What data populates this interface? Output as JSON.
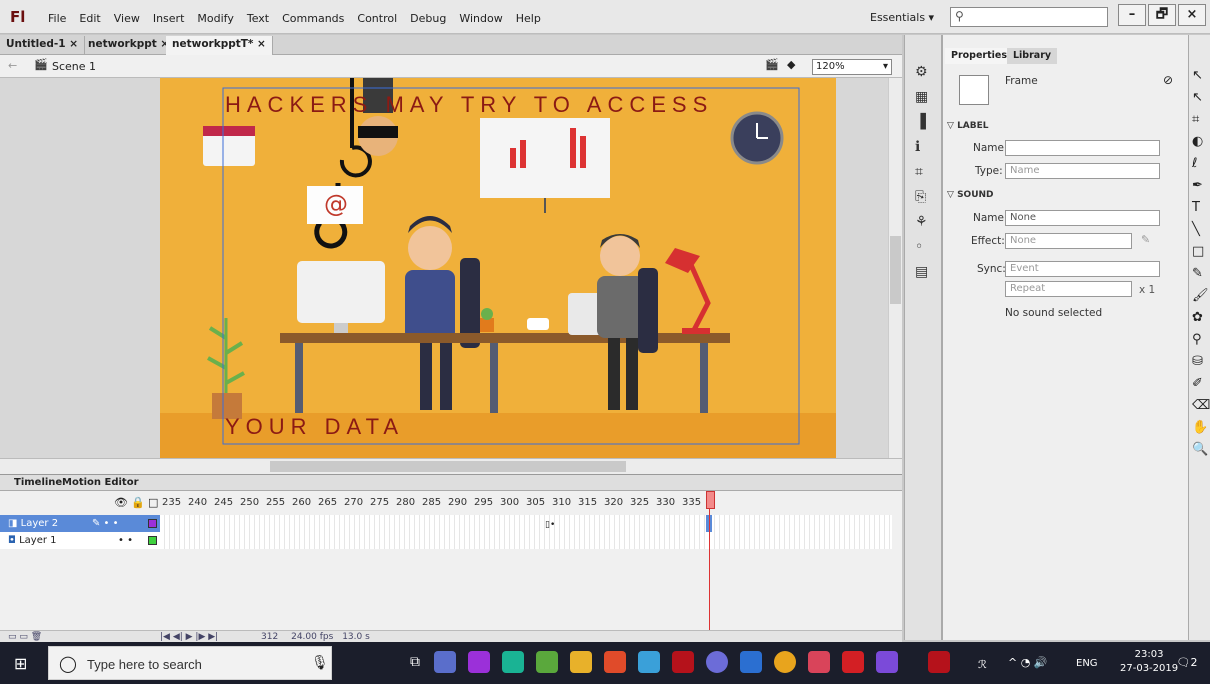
{
  "app": {
    "logo": "Fl"
  },
  "menu": [
    "File",
    "Edit",
    "View",
    "Insert",
    "Modify",
    "Text",
    "Commands",
    "Control",
    "Debug",
    "Window",
    "Help"
  ],
  "workspace": "Essentials",
  "window_buttons": [
    "–",
    "🗗",
    "×"
  ],
  "tabs": [
    {
      "label": "Untitled-1 ×",
      "active": false
    },
    {
      "label": "networkppt ×",
      "active": false
    },
    {
      "label": "networkpptT* ×",
      "active": true
    }
  ],
  "scene": {
    "label": "Scene 1",
    "zoom": "120%"
  },
  "stage_text": {
    "top": "HACKERS MAY TRY TO ACCESS",
    "bottom": "YOUR DATA",
    "email_symbol": "@"
  },
  "timeline": {
    "tabs": [
      "Timeline",
      "Motion Editor"
    ],
    "ruler": [
      "235",
      "240",
      "245",
      "250",
      "255",
      "260",
      "265",
      "270",
      "275",
      "280",
      "285",
      "290",
      "295",
      "300",
      "305",
      "310",
      "315",
      "320",
      "325",
      "330",
      "335"
    ],
    "layers": [
      {
        "name": "Layer 2",
        "selected": true,
        "color": "#9b30d9"
      },
      {
        "name": "Layer 1",
        "selected": false,
        "color": "#3fd13f"
      }
    ],
    "footer": {
      "frame": "312",
      "fps": "24.00 fps",
      "time": "13.0 s"
    }
  },
  "properties": {
    "tabs": [
      "Properties",
      "Library"
    ],
    "type": "Frame",
    "label_section": "LABEL",
    "name_label": "Name:",
    "type_label": "Type:",
    "type_value": "Name",
    "sound_section": "SOUND",
    "sound_name_label": "Name:",
    "sound_name_value": "None",
    "effect_label": "Effect:",
    "effect_value": "None",
    "sync_label": "Sync:",
    "sync_value": "Event",
    "repeat_value": "Repeat",
    "repeat_count": "x 1",
    "status": "No sound selected"
  },
  "taskbar": {
    "search_placeholder": "Type here to search",
    "lang": "ENG",
    "time": "23:03",
    "date": "27-03-2019",
    "notifications": "2"
  }
}
